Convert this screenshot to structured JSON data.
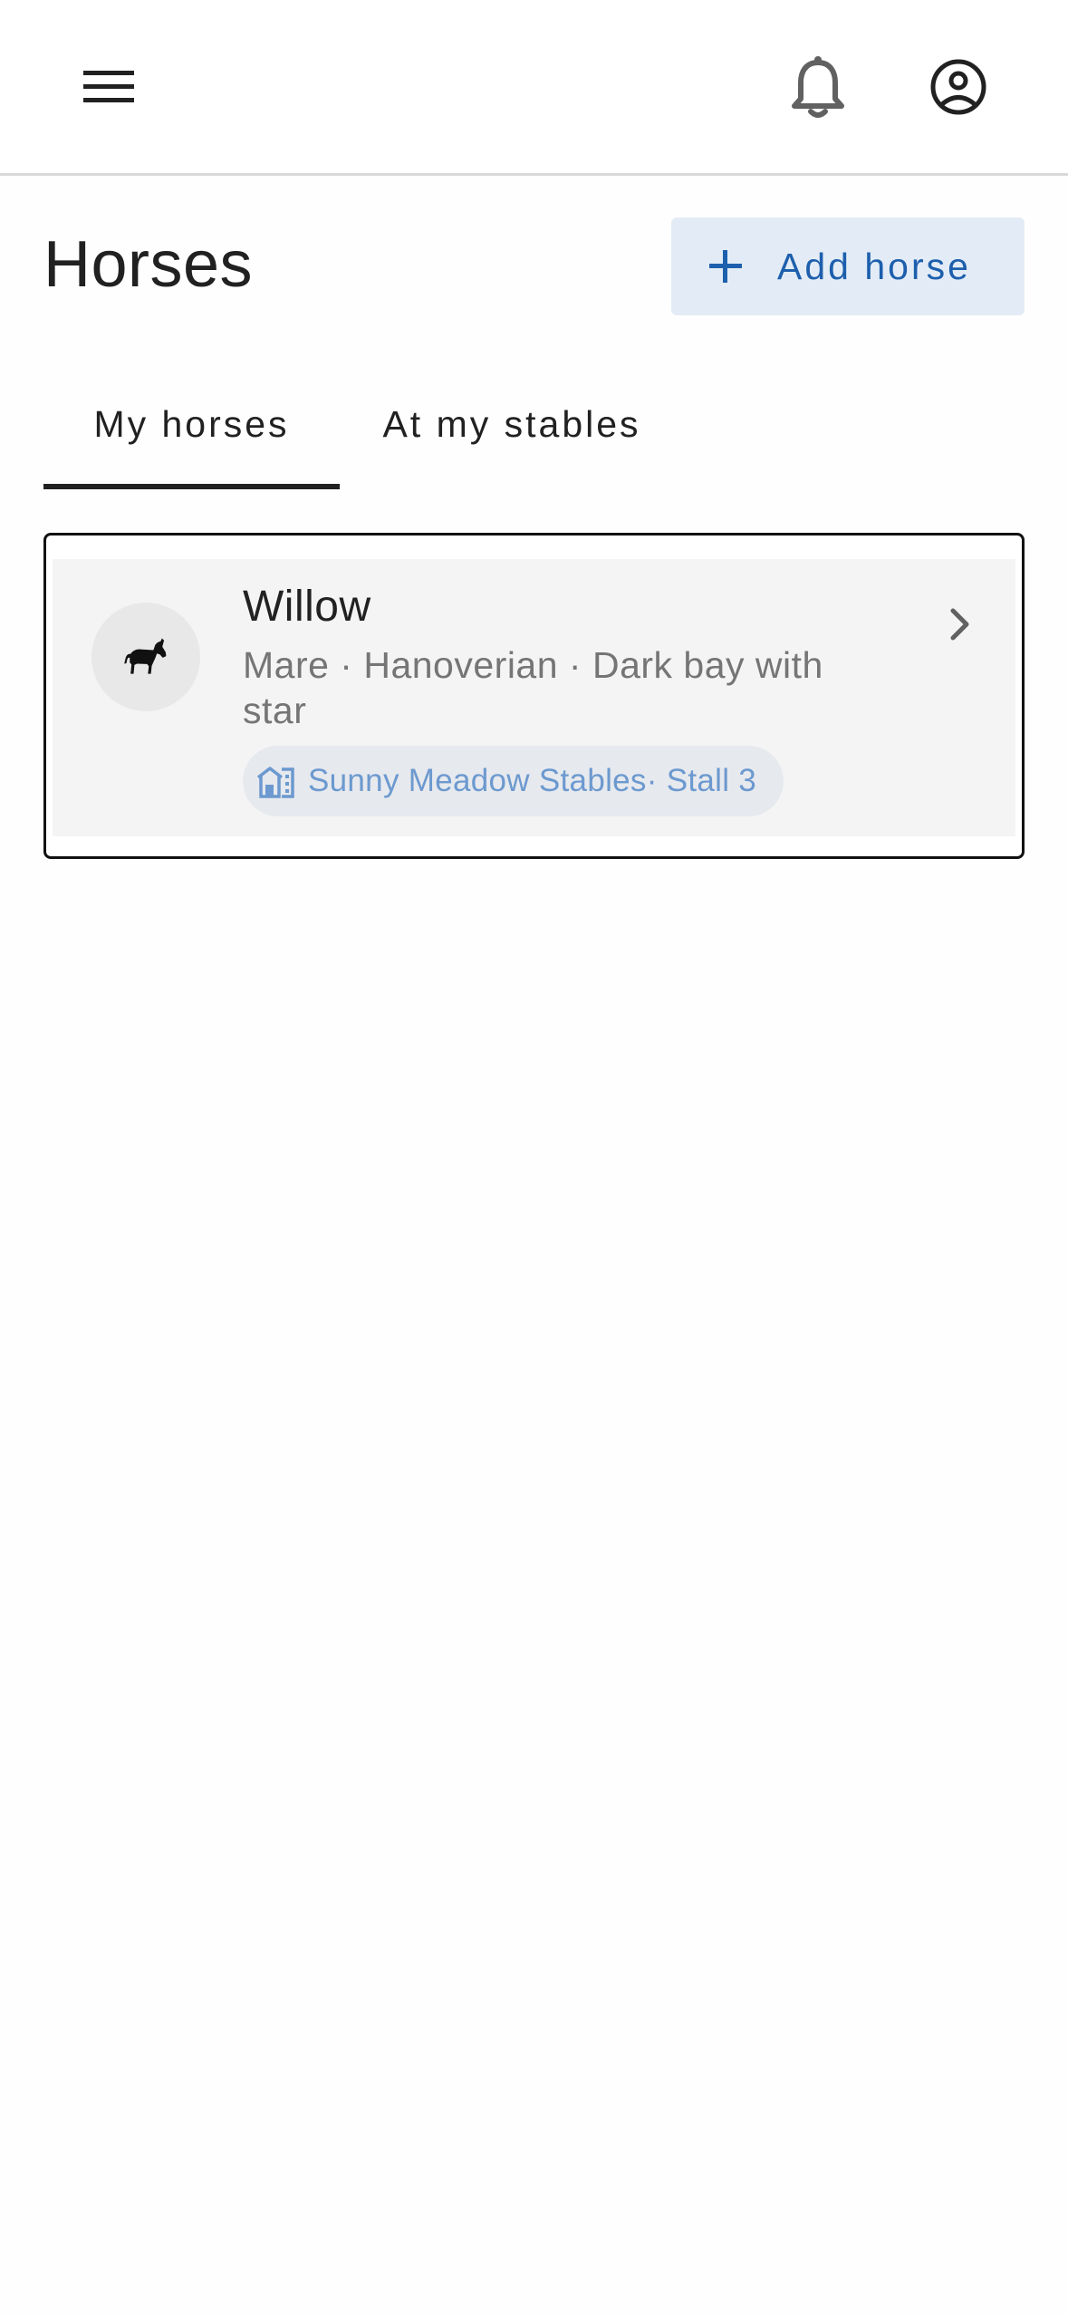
{
  "appbar": {
    "menu_icon": "menu-icon",
    "notifications_icon": "bell-icon",
    "account_icon": "account-circle-icon"
  },
  "header": {
    "title": "Horses",
    "add_button_label": "Add horse",
    "add_button_icon": "plus-icon"
  },
  "tabs": [
    {
      "label": "My horses",
      "active": true
    },
    {
      "label": "At my stables",
      "active": false
    }
  ],
  "horses": [
    {
      "name": "Willow",
      "meta": "Mare · Hanoverian · Dark bay with star",
      "location": "Sunny Meadow Stables· Stall 3",
      "avatar_icon": "horse-icon",
      "location_icon": "stable-building-icon"
    }
  ],
  "colors": {
    "accent": "#1d5fad",
    "accent_bg": "#e3ecf6",
    "chip_text": "#6c99cf",
    "text_primary": "#212121",
    "text_secondary": "#757575"
  }
}
